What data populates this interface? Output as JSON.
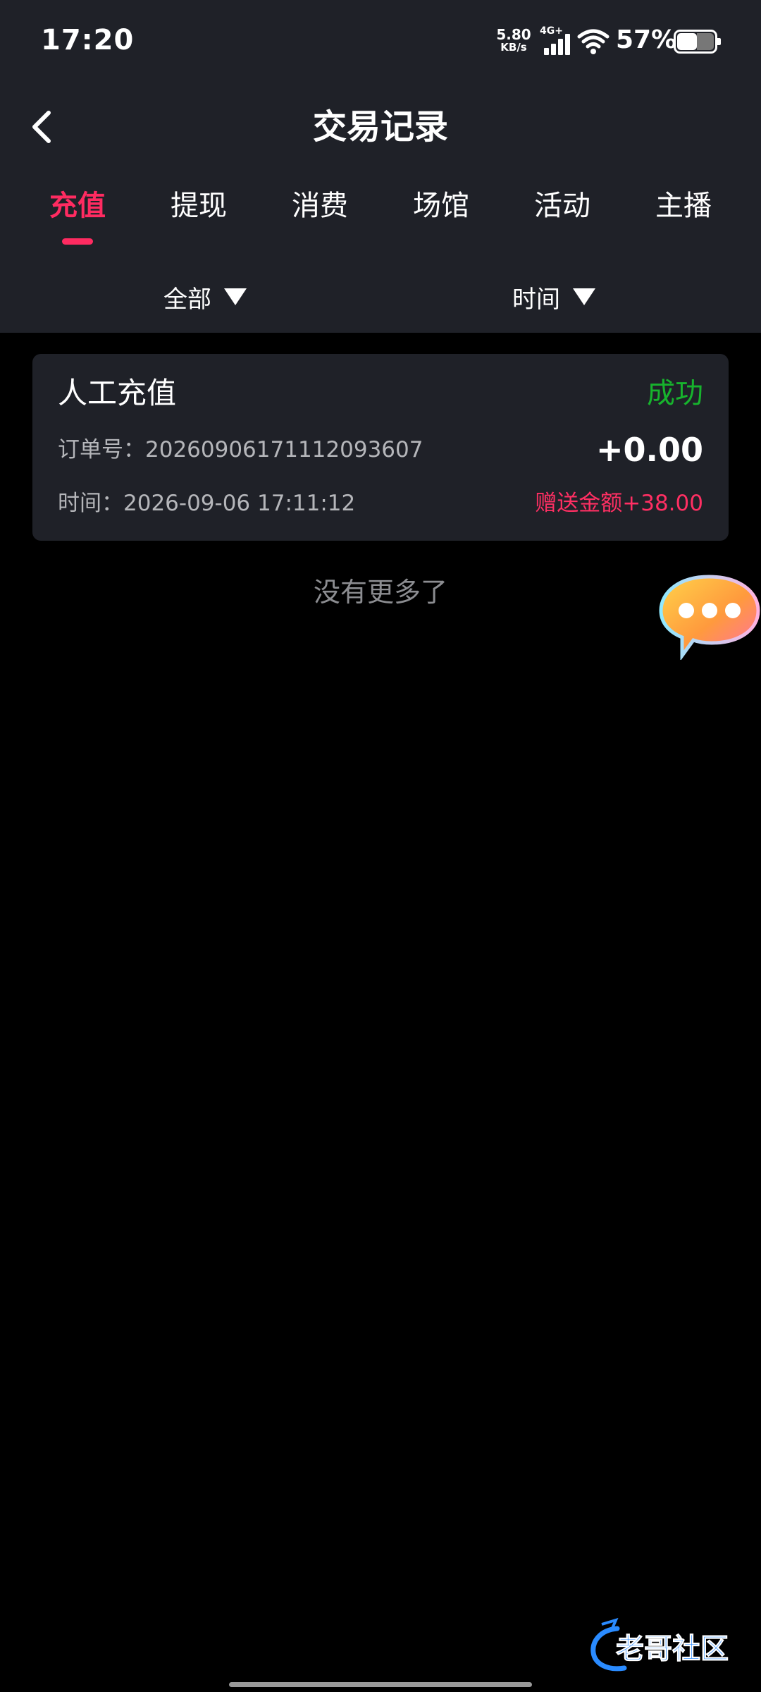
{
  "status_bar": {
    "time": "17:20",
    "net_speed_value": "5.80",
    "net_speed_unit": "KB/s",
    "network_type": "4G+",
    "battery_percent": "57%",
    "battery_level": 0.57
  },
  "header": {
    "title": "交易记录",
    "back_icon": "chevron-left-icon"
  },
  "tabs": [
    {
      "label": "充值",
      "active": true
    },
    {
      "label": "提现",
      "active": false
    },
    {
      "label": "消费",
      "active": false
    },
    {
      "label": "场馆",
      "active": false
    },
    {
      "label": "活动",
      "active": false
    },
    {
      "label": "主播",
      "active": false
    }
  ],
  "filters": {
    "type_label": "全部",
    "time_label": "时间"
  },
  "records": [
    {
      "title": "人工充值",
      "status": "成功",
      "order_no": "订单号：20260906171112093607",
      "amount": "+0.00",
      "time": "时间：2026-09-06 17:11:12",
      "bonus": "赠送金额+38.00"
    }
  ],
  "list_end_text": "没有更多了",
  "watermark_text": "老哥社区",
  "colors": {
    "accent": "#ff2b61",
    "success": "#17b32d",
    "panel": "#1f2128",
    "background": "#000000"
  }
}
